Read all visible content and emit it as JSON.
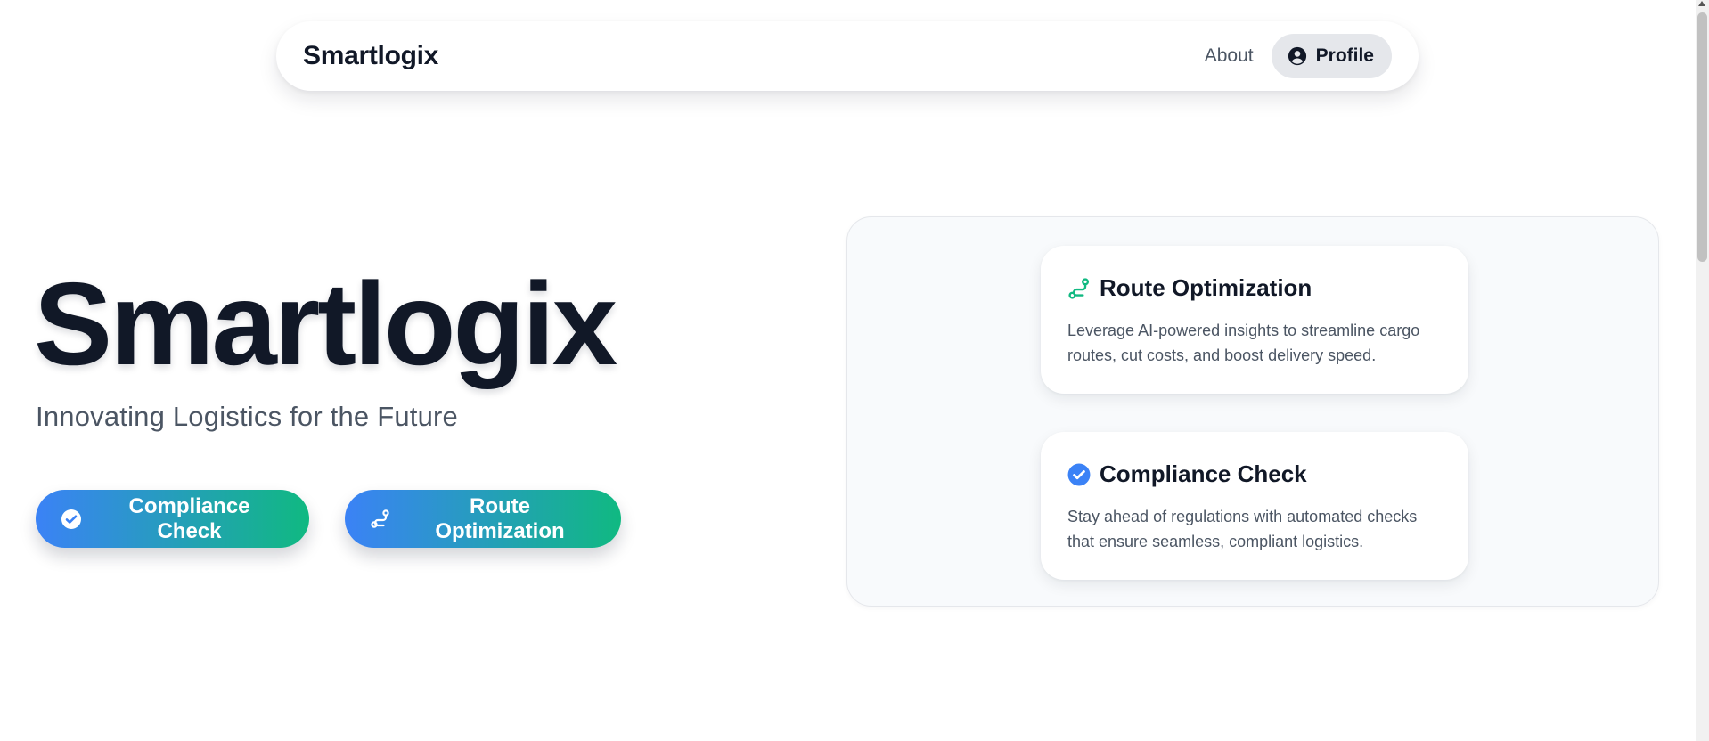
{
  "nav": {
    "brand": "Smartlogix",
    "about_label": "About",
    "profile_label": "Profile"
  },
  "hero": {
    "title": "Smartlogix",
    "subtitle": "Innovating Logistics for the Future",
    "buttons": [
      {
        "label": "Compliance Check",
        "icon": "check-circle-icon"
      },
      {
        "label": "Route Optimization",
        "icon": "route-icon"
      }
    ]
  },
  "features": [
    {
      "title": "Route Optimization",
      "description": "Leverage AI-powered insights to streamline cargo routes, cut costs, and boost delivery speed.",
      "icon": "route-icon",
      "icon_color": "#10b981"
    },
    {
      "title": "Compliance Check",
      "description": "Stay ahead of regulations with automated checks that ensure seamless, compliant logistics.",
      "icon": "check-circle-icon",
      "icon_color": "#3b82f6"
    }
  ],
  "colors": {
    "gradient_start": "#3b82f6",
    "gradient_end": "#10b981",
    "text_dark": "#111827",
    "text_muted": "#4b5563",
    "panel_bg": "#f8fafc"
  }
}
